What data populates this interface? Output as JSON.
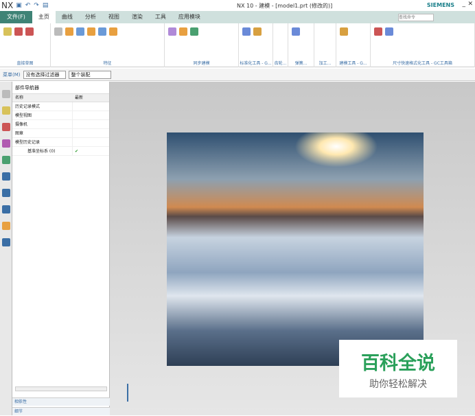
{
  "titlebar": {
    "app": "NX",
    "title": "NX 10 - 建模 - [model1.prt (修改的)]",
    "brand": "SIEMENS"
  },
  "tabs": [
    "文件(F)",
    "主页",
    "曲线",
    "分析",
    "视图",
    "渲染",
    "工具",
    "应用模块"
  ],
  "search_placeholder": "查找命令",
  "ribbon_groups": [
    "直接草图",
    "特征",
    "同步建模",
    "标准化工具 - G...",
    "齿轮...",
    "弹簧...",
    "加工...",
    "建模工具 - G...",
    "尺寸快速格式化工具 - GC工具箱"
  ],
  "toolbar2": {
    "menu": "菜单(M)",
    "filter": "没有选择过滤器",
    "scope": "整个装配"
  },
  "navigator": {
    "title": "部件导航器",
    "columns": [
      "名称",
      "最新"
    ],
    "rows": [
      {
        "name": "历史记录模式",
        "latest": ""
      },
      {
        "name": "模型视图",
        "latest": ""
      },
      {
        "name": "摄像机",
        "latest": ""
      },
      {
        "name": "图章",
        "latest": ""
      },
      {
        "name": "模型历史记录",
        "latest": ""
      },
      {
        "name": "基准坐标系 (0)",
        "latest": "✔"
      }
    ],
    "panels": [
      "相依性",
      "细节"
    ]
  },
  "watermark": {
    "line1": "百科全说",
    "line2": "助你轻松解决"
  }
}
